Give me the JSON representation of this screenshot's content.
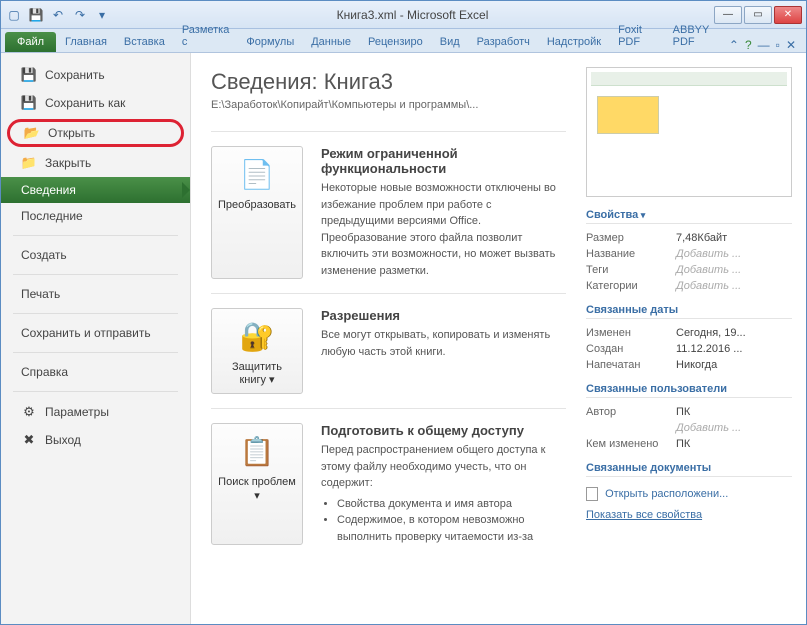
{
  "titlebar": {
    "text": "Книга3.xml - Microsoft Excel"
  },
  "ribbon_tabs": {
    "file": "Файл",
    "home": "Главная",
    "insert": "Вставка",
    "layout": "Разметка с",
    "formulas": "Формулы",
    "data": "Данные",
    "review": "Рецензиро",
    "view": "Вид",
    "developer": "Разработч",
    "addins": "Надстройк",
    "foxit": "Foxit PDF",
    "abbyy": "ABBYY PDF"
  },
  "nav": {
    "save": "Сохранить",
    "save_as": "Сохранить как",
    "open": "Открыть",
    "close": "Закрыть",
    "info": "Сведения",
    "recent": "Последние",
    "new": "Создать",
    "print": "Печать",
    "share": "Сохранить и отправить",
    "help": "Справка",
    "options": "Параметры",
    "exit": "Выход"
  },
  "info": {
    "title": "Сведения: Книга3",
    "path": "E:\\Заработок\\Копирайт\\Компьютеры и программы\\...",
    "convert": {
      "btn": "Преобразовать",
      "heading": "Режим ограниченной функциональности",
      "body": "Некоторые новые возможности отключены во избежание проблем при работе с предыдущими версиями Office. Преобразование этого файла позволит включить эти возможности, но может вызвать изменение разметки."
    },
    "protect": {
      "btn": "Защитить книгу ▾",
      "heading": "Разрешения",
      "body": "Все могут открывать, копировать и изменять любую часть этой книги."
    },
    "check": {
      "btn": "Поиск проблем ▾",
      "heading": "Подготовить к общему доступу",
      "body": "Перед распространением общего доступа к этому файлу необходимо учесть, что он содержит:",
      "li1": "Свойства документа и имя автора",
      "li2": "Содержимое, в котором невозможно выполнить проверку читаемости из-за"
    }
  },
  "props": {
    "heading_main": "Свойства",
    "size_l": "Размер",
    "size_v": "7,48Кбайт",
    "title_l": "Название",
    "title_v": "Добавить ...",
    "tags_l": "Теги",
    "tags_v": "Добавить ...",
    "cat_l": "Категории",
    "cat_v": "Добавить ...",
    "heading_dates": "Связанные даты",
    "mod_l": "Изменен",
    "mod_v": "Сегодня, 19...",
    "created_l": "Создан",
    "created_v": "11.12.2016 ...",
    "printed_l": "Напечатан",
    "printed_v": "Никогда",
    "heading_users": "Связанные пользователи",
    "author_l": "Автор",
    "author_v": "ПК",
    "author_add": "Добавить ...",
    "lastmod_l": "Кем изменено",
    "lastmod_v": "ПК",
    "heading_docs": "Связанные документы",
    "open_location": "Открыть расположени...",
    "show_all": "Показать все свойства"
  }
}
